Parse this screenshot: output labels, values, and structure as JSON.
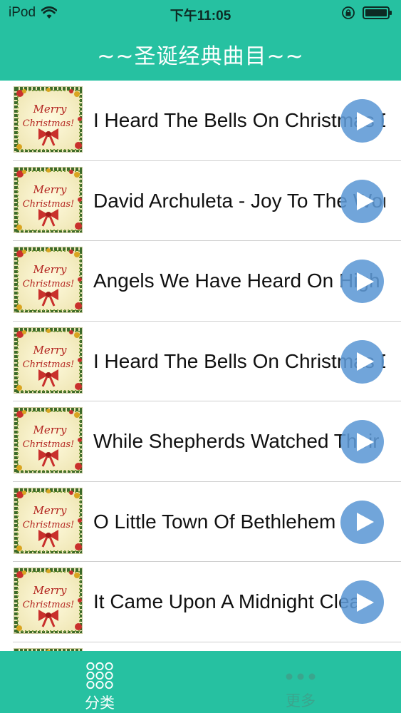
{
  "status_bar": {
    "device": "iPod",
    "time": "下午11:05",
    "icons": [
      "wifi-icon",
      "orientation-lock-icon",
      "battery-icon"
    ]
  },
  "nav": {
    "title": "~~圣诞经典曲目~~"
  },
  "songs": [
    {
      "title": "I Heard The Bells On Christmas Day",
      "art": "merry-christmas-art",
      "action": "play-icon"
    },
    {
      "title": "David Archuleta - Joy To The World",
      "art": "merry-christmas-art",
      "action": "play-icon"
    },
    {
      "title": " Angels We Have Heard On High",
      "art": "merry-christmas-art",
      "action": "play-icon"
    },
    {
      "title": "I Heard The Bells On Christmas Day",
      "art": "merry-christmas-art",
      "action": "play-icon"
    },
    {
      "title": "While Shepherds Watched Their Flocks",
      "art": "merry-christmas-art",
      "action": "play-icon"
    },
    {
      "title": " O Little Town Of Bethlehem",
      "art": "merry-christmas-art",
      "action": "play-icon"
    },
    {
      "title": "It Came Upon A Midnight Clear",
      "art": "merry-christmas-art",
      "action": "play-icon"
    }
  ],
  "album_art": {
    "line1": "Merry",
    "line2": "Christmas!"
  },
  "tab_bar": {
    "tabs": [
      {
        "label": "分类",
        "icon": "grid-icon",
        "selected": true
      },
      {
        "label": "更多",
        "icon": "more-dots-icon",
        "selected": false
      }
    ]
  },
  "colors": {
    "accent": "#26c1a1",
    "play_button": "#5d98d5",
    "divider": "#cfcfcf",
    "inactive_tab": "#3aa58d"
  }
}
